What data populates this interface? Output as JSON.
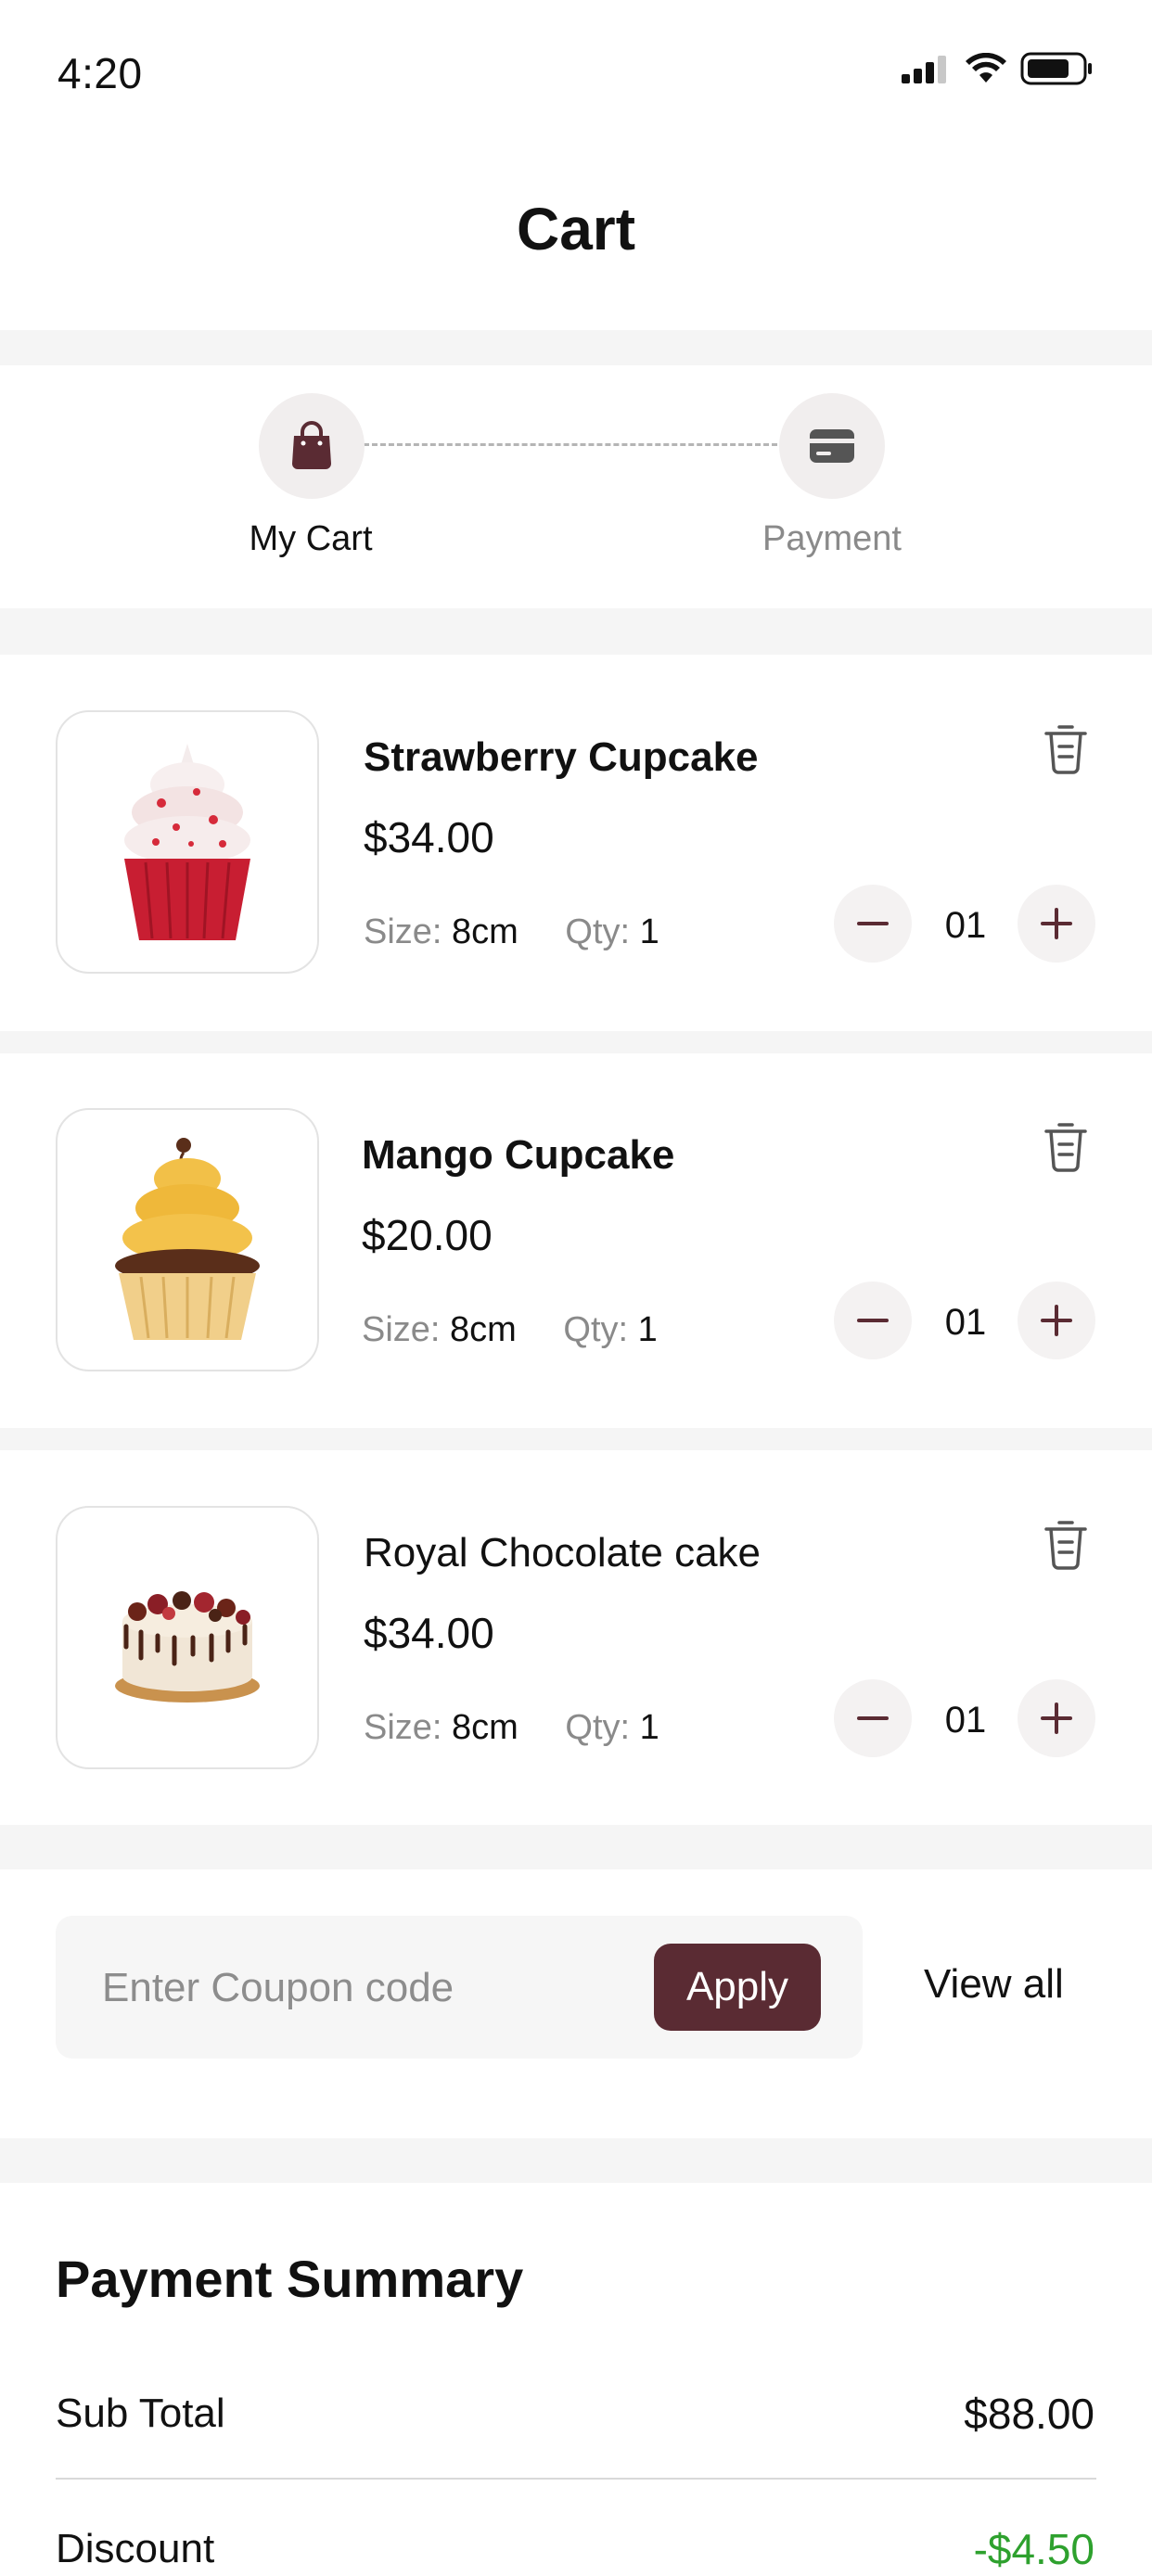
{
  "status_bar": {
    "time": "4:20"
  },
  "header": {
    "title": "Cart"
  },
  "steps": [
    {
      "label": "My Cart",
      "icon": "shopping-bag-icon"
    },
    {
      "label": "Payment",
      "icon": "credit-card-icon"
    }
  ],
  "cart_items": [
    {
      "name": "Strawberry Cupcake",
      "price": "$34.00",
      "size_label": "Size:",
      "size": "8cm",
      "qty_label": "Qty:",
      "qty": "1",
      "quantity": "01"
    },
    {
      "name": "Mango Cupcake",
      "price": "$20.00",
      "size_label": "Size:",
      "size": "8cm",
      "qty_label": "Qty:",
      "qty": "1",
      "quantity": "01"
    },
    {
      "name": "Royal Chocolate cake",
      "price": "$34.00",
      "size_label": "Size:",
      "size": "8cm",
      "qty_label": "Qty:",
      "qty": "1",
      "quantity": "01"
    }
  ],
  "coupon": {
    "placeholder": "Enter Coupon code",
    "apply_label": "Apply",
    "view_all_label": "View all"
  },
  "payment_summary": {
    "title": "Payment Summary",
    "rows": [
      {
        "label": "Sub Total",
        "value": "$88.00"
      },
      {
        "label": "Discount",
        "value": "-$4.50"
      }
    ]
  },
  "colors": {
    "accent": "#5a2b33",
    "discount": "#2ea12e",
    "muted": "#8a8a8a"
  }
}
